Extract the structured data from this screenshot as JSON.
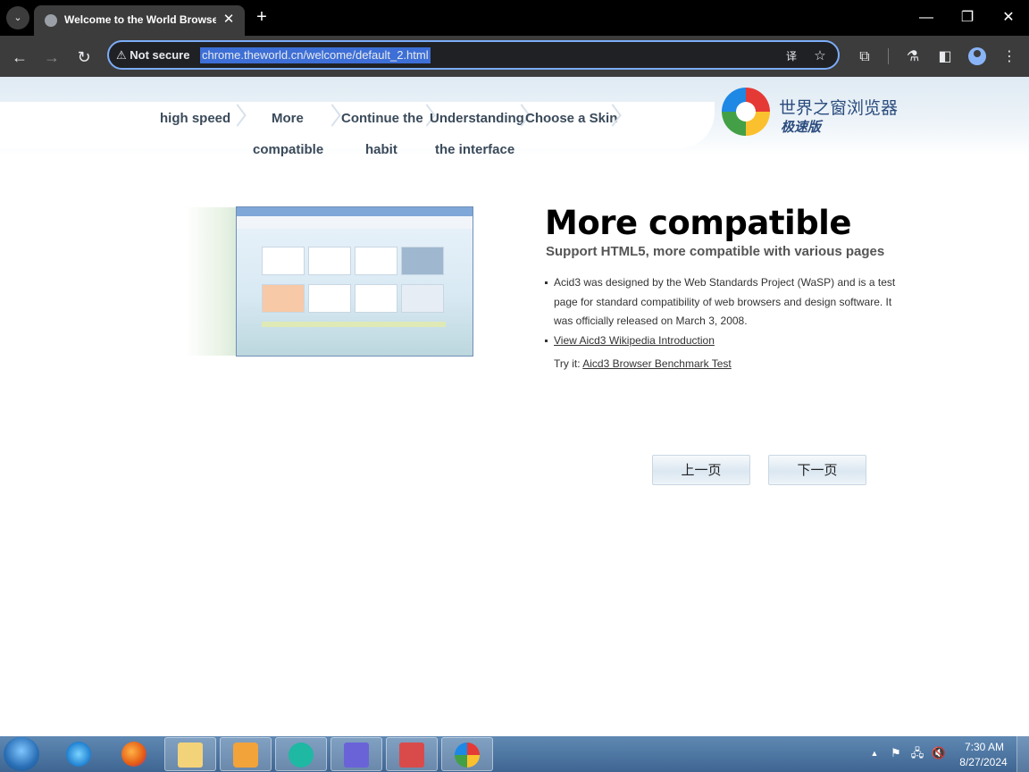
{
  "browser": {
    "tab": {
      "title": "Welcome to the World Browser",
      "close": "✕"
    },
    "tab_search": "⌄",
    "new_tab": "+",
    "window": {
      "minimize": "—",
      "restore": "❐",
      "close": "✕"
    },
    "nav": {
      "back": "←",
      "forward": "→",
      "reload": "↻"
    },
    "omnibox": {
      "security": "⚠ Not secure",
      "url": "chrome.theworld.cn/welcome/default_2.html"
    },
    "icons": {
      "translate": "译",
      "bookmark": "☆",
      "extensions": "⧉",
      "labs": "⚗",
      "side_panel": "◧",
      "menu": "⋮"
    }
  },
  "page": {
    "nav": [
      {
        "label": "high speed"
      },
      {
        "label": "More"
      },
      {
        "label": "Continue the"
      },
      {
        "label": "Understanding"
      },
      {
        "label": "Choose a Skin"
      }
    ],
    "nav_row2": [
      {
        "label": "compatible"
      },
      {
        "label": "habit"
      },
      {
        "label": "the interface"
      }
    ],
    "logo": {
      "name": "世界之窗浏览器",
      "edition": "极速版"
    },
    "title": "More compatible",
    "subtitle": "Support HTML5, more compatible with various pages",
    "bullets": [
      {
        "text": "Acid3 was designed by the Web Standards Project (WaSP) and is a test page for standard compatibility of web browsers and design software. It was officially released on March 3, 2008."
      },
      {
        "link": "View Aicd3 Wikipedia Introduction"
      }
    ],
    "try_it": {
      "label": "Try it:",
      "link": "Aicd3 Browser Benchmark Test"
    },
    "buttons": {
      "prev": "上一页",
      "next": "下一页"
    }
  },
  "taskbar": {
    "clock": {
      "time": "7:30 AM",
      "date": "8/27/2024"
    },
    "tray": {
      "show_hidden": "▲",
      "flag": "⚑",
      "network": "🖧",
      "volume": "🔇"
    }
  }
}
